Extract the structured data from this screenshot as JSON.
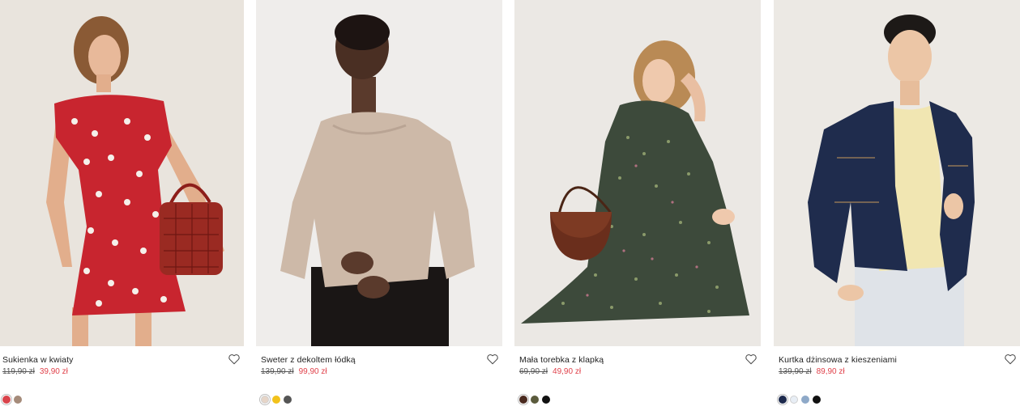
{
  "products": [
    {
      "name": "Sukienka w kwiaty",
      "old_price": "119,90 zł",
      "new_price": "39,90 zł",
      "colors": [
        "#d9434b",
        "#a58b7a"
      ],
      "photo_bg": "#e8e3dc"
    },
    {
      "name": "Sweter z dekoltem łódką",
      "old_price": "139,90 zł",
      "new_price": "99,90 zł",
      "colors": [
        "#e6d5c8",
        "#f2c21b",
        "#555555"
      ],
      "photo_bg": "#eeeceb"
    },
    {
      "name": "Mała torebka z klapką",
      "old_price": "69,90 zł",
      "new_price": "49,90 zł",
      "colors": [
        "#4a2a1f",
        "#5b5b3d",
        "#111111"
      ],
      "photo_bg": "#e9e6e3"
    },
    {
      "name": "Kurtka dżinsowa z kieszeniami",
      "old_price": "139,90 zł",
      "new_price": "89,90 zł",
      "colors": [
        "#1d2a4d",
        "#e8eef5",
        "#8ea9c8",
        "#111111"
      ],
      "photo_bg": "#ebe8e3"
    }
  ],
  "icons": {
    "favorite": "heart-outline-icon"
  }
}
